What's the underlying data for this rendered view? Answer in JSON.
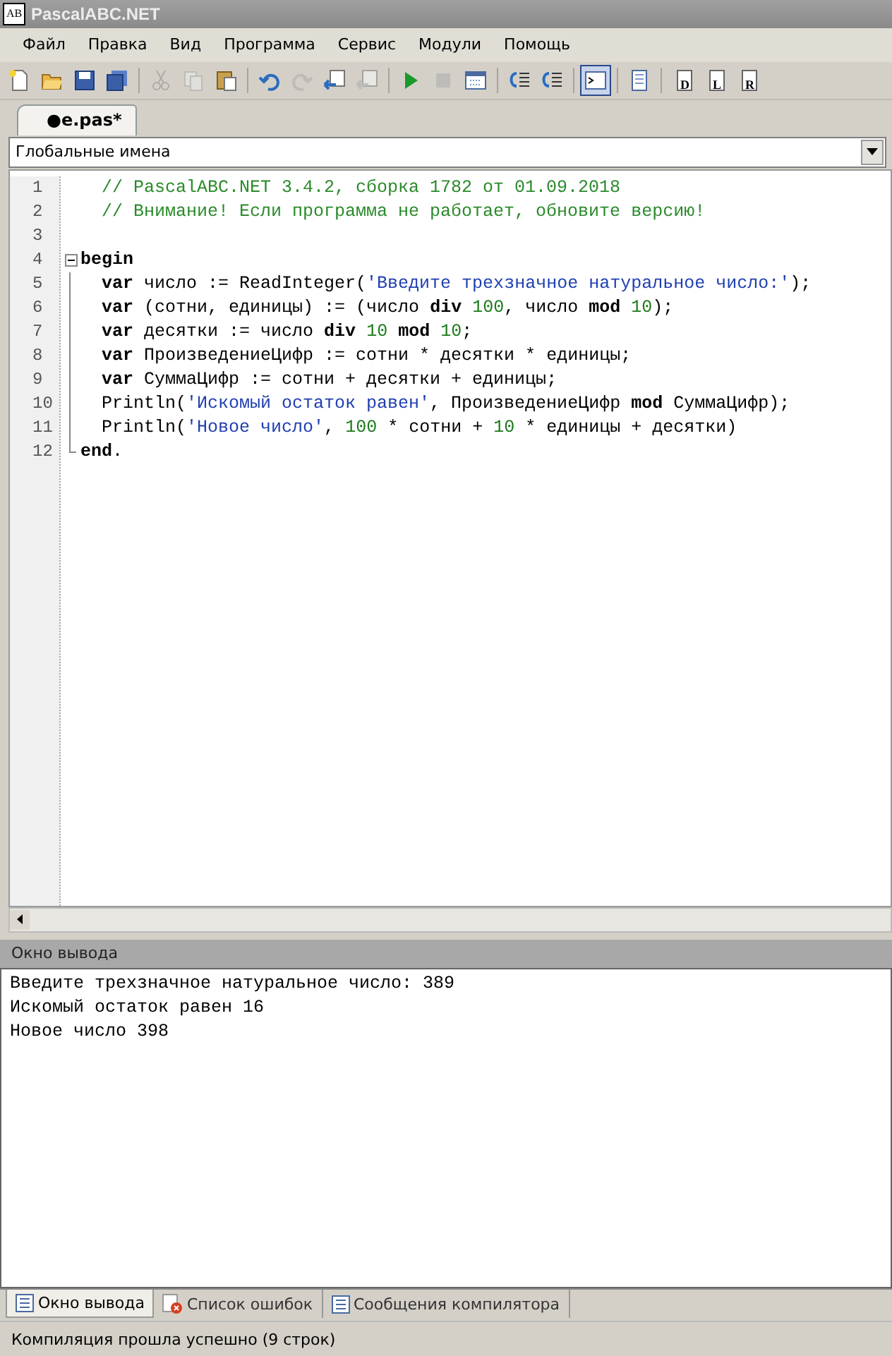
{
  "window": {
    "title": "PascalABC.NET",
    "logo": "AB"
  },
  "menu": [
    "Файл",
    "Правка",
    "Вид",
    "Программа",
    "Сервис",
    "Модули",
    "Помощь"
  ],
  "toolbar": [
    {
      "kind": "new",
      "disabled": false,
      "selected": false
    },
    {
      "kind": "open",
      "disabled": false,
      "selected": false
    },
    {
      "kind": "save",
      "disabled": false,
      "selected": false
    },
    {
      "kind": "saveall",
      "disabled": false,
      "selected": false
    },
    {
      "kind": "sep"
    },
    {
      "kind": "cut",
      "disabled": true,
      "selected": false
    },
    {
      "kind": "copy",
      "disabled": true,
      "selected": false
    },
    {
      "kind": "paste",
      "disabled": false,
      "selected": false
    },
    {
      "kind": "sep"
    },
    {
      "kind": "undo",
      "disabled": false,
      "selected": false
    },
    {
      "kind": "redo",
      "disabled": true,
      "selected": false
    },
    {
      "kind": "back",
      "disabled": false,
      "selected": false
    },
    {
      "kind": "forward",
      "disabled": true,
      "selected": false
    },
    {
      "kind": "sep"
    },
    {
      "kind": "run",
      "disabled": false,
      "selected": false
    },
    {
      "kind": "stop",
      "disabled": true,
      "selected": false
    },
    {
      "kind": "build",
      "disabled": false,
      "selected": false
    },
    {
      "kind": "sep"
    },
    {
      "kind": "stepin",
      "disabled": false,
      "selected": false
    },
    {
      "kind": "stepover",
      "disabled": false,
      "selected": false
    },
    {
      "kind": "sep"
    },
    {
      "kind": "console",
      "disabled": false,
      "selected": true
    },
    {
      "kind": "sep"
    },
    {
      "kind": "doc",
      "disabled": false,
      "selected": false
    },
    {
      "kind": "sep"
    },
    {
      "kind": "letter",
      "label": "D",
      "disabled": false,
      "selected": false
    },
    {
      "kind": "letter",
      "label": "L",
      "disabled": false,
      "selected": false
    },
    {
      "kind": "letter",
      "label": "R",
      "disabled": false,
      "selected": false
    }
  ],
  "editor_tabs": [
    {
      "label": "●e.pas*",
      "selected": true
    }
  ],
  "scope_dropdown": {
    "value": "Глобальные имена"
  },
  "code": [
    {
      "number": "1",
      "kind": "plain",
      "tokens": [
        {
          "kind": "comment",
          "text": "  // PascalABC.NET 3.4.2, сборка 1782 от 01.09.2018"
        }
      ]
    },
    {
      "number": "2",
      "kind": "plain",
      "tokens": [
        {
          "kind": "comment",
          "text": "  // Внимание! Если программа не работает, обновите версию!"
        }
      ]
    },
    {
      "number": "3",
      "kind": "plain"
    },
    {
      "number": "4",
      "kind": "fold_start",
      "tokens": [
        {
          "kind": "keyword",
          "text": "begin"
        }
      ]
    },
    {
      "number": "5",
      "kind": "fold_body",
      "tokens": [
        {
          "kind": "keyword",
          "text": "  var"
        },
        {
          "kind": "plain",
          "text": " число := ReadInteger("
        },
        {
          "kind": "string",
          "text": "'Введите трехзначное натуральное число:'"
        },
        {
          "kind": "plain",
          "text": ");"
        }
      ]
    },
    {
      "number": "6",
      "kind": "fold_body",
      "tokens": [
        {
          "kind": "keyword",
          "text": "  var"
        },
        {
          "kind": "plain",
          "text": " (сотни, единицы) := (число "
        },
        {
          "kind": "keyword",
          "text": "div"
        },
        {
          "kind": "number",
          "text": " 100"
        },
        {
          "kind": "plain",
          "text": ", число "
        },
        {
          "kind": "keyword",
          "text": "mod"
        },
        {
          "kind": "number",
          "text": " 10"
        },
        {
          "kind": "plain",
          "text": ");"
        }
      ]
    },
    {
      "number": "7",
      "kind": "fold_body",
      "tokens": [
        {
          "kind": "keyword",
          "text": "  var"
        },
        {
          "kind": "plain",
          "text": " десятки := число "
        },
        {
          "kind": "keyword",
          "text": "div"
        },
        {
          "kind": "number",
          "text": " 10"
        },
        {
          "kind": "keyword",
          "text": " mod"
        },
        {
          "kind": "number",
          "text": " 10"
        },
        {
          "kind": "plain",
          "text": ";"
        }
      ]
    },
    {
      "number": "8",
      "kind": "fold_body",
      "tokens": [
        {
          "kind": "keyword",
          "text": "  var"
        },
        {
          "kind": "plain",
          "text": " ПроизведениеЦифр := сотни * десятки * единицы;"
        }
      ]
    },
    {
      "number": "9",
      "kind": "fold_body",
      "tokens": [
        {
          "kind": "keyword",
          "text": "  var"
        },
        {
          "kind": "plain",
          "text": " СуммаЦифр := сотни + десятки + единицы;"
        }
      ]
    },
    {
      "number": "10",
      "kind": "fold_body",
      "tokens": [
        {
          "kind": "plain",
          "text": "  Println("
        },
        {
          "kind": "string",
          "text": "'Искомый остаток равен'"
        },
        {
          "kind": "plain",
          "text": ", ПроизведениеЦифр "
        },
        {
          "kind": "keyword",
          "text": "mod"
        },
        {
          "kind": "plain",
          "text": " СуммаЦифр);"
        }
      ]
    },
    {
      "number": "11",
      "kind": "fold_body",
      "tokens": [
        {
          "kind": "plain",
          "text": "  Println("
        },
        {
          "kind": "string",
          "text": "'Новое число'"
        },
        {
          "kind": "plain",
          "text": ", "
        },
        {
          "kind": "number",
          "text": "100"
        },
        {
          "kind": "plain",
          "text": " * сотни + "
        },
        {
          "kind": "number",
          "text": "10"
        },
        {
          "kind": "plain",
          "text": " * единицы + десятки)"
        }
      ]
    },
    {
      "number": "12",
      "kind": "fold_end",
      "tokens": [
        {
          "kind": "keyword",
          "text": "end"
        },
        {
          "kind": "plain",
          "text": "."
        }
      ]
    }
  ],
  "output_panel": {
    "title": "Окно вывода",
    "lines": [
      "Введите трехзначное натуральное число: 389",
      "Искомый остаток равен 16",
      "Новое число 398"
    ]
  },
  "bottom_tabs": [
    {
      "label": "Окно вывода",
      "kind": "output",
      "selected": true
    },
    {
      "label": "Список ошибок",
      "kind": "errors",
      "selected": false
    },
    {
      "label": "Сообщения компилятора",
      "kind": "messages",
      "selected": false
    }
  ],
  "status_bar": "Компиляция прошла успешно (9 строк)"
}
